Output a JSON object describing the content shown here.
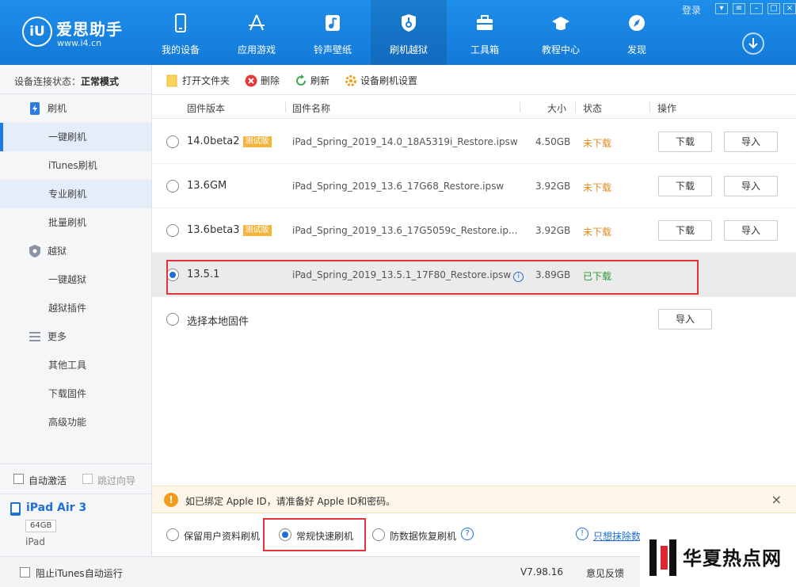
{
  "header": {
    "logo_mark": "iU",
    "logo_name": "爱思助手",
    "logo_url": "www.i4.cn",
    "login": "登录",
    "nav": [
      {
        "label": "我的设备",
        "icon": "phone-icon"
      },
      {
        "label": "应用游戏",
        "icon": "app-store-icon"
      },
      {
        "label": "铃声壁纸",
        "icon": "music-note-icon"
      },
      {
        "label": "刷机越狱",
        "icon": "shield-key-icon"
      },
      {
        "label": "工具箱",
        "icon": "toolbox-icon"
      },
      {
        "label": "教程中心",
        "icon": "graduation-cap-icon"
      },
      {
        "label": "发现",
        "icon": "compass-icon"
      }
    ],
    "active_nav": 3
  },
  "sidebar": {
    "conn_label": "设备连接状态：",
    "conn_value": "正常模式",
    "items": [
      {
        "label": "刷机",
        "type": "group",
        "icon": "phone-flash-icon"
      },
      {
        "label": "一键刷机",
        "type": "sub"
      },
      {
        "label": "iTunes刷机",
        "type": "sub"
      },
      {
        "label": "专业刷机",
        "type": "sub"
      },
      {
        "label": "批量刷机",
        "type": "sub"
      },
      {
        "label": "越狱",
        "type": "group",
        "icon": "shield-icon"
      },
      {
        "label": "一键越狱",
        "type": "sub"
      },
      {
        "label": "越狱插件",
        "type": "sub"
      },
      {
        "label": "更多",
        "type": "group",
        "icon": "menu-icon"
      },
      {
        "label": "其他工具",
        "type": "sub"
      },
      {
        "label": "下载固件",
        "type": "sub"
      },
      {
        "label": "高级功能",
        "type": "sub"
      }
    ],
    "auto_activate": "自动激活",
    "skip_guide": "跳过向导",
    "device_name": "iPad Air 3",
    "device_storage": "64GB",
    "device_type": "iPad"
  },
  "toolbar": {
    "open_folder": "打开文件夹",
    "delete": "删除",
    "refresh": "刷新",
    "settings": "设备刷机设置"
  },
  "table": {
    "headers": {
      "version": "固件版本",
      "name": "固件名称",
      "size": "大小",
      "status": "状态",
      "action": "操作"
    },
    "rows": [
      {
        "version": "14.0beta2",
        "badge": "测试版",
        "name": "iPad_Spring_2019_14.0_18A5319i_Restore.ipsw",
        "size": "4.50GB",
        "status": "未下载",
        "btn1": "下载",
        "btn2": "导入"
      },
      {
        "version": "13.6GM",
        "badge": "",
        "name": "iPad_Spring_2019_13.6_17G68_Restore.ipsw",
        "size": "3.92GB",
        "status": "未下载",
        "btn1": "下载",
        "btn2": "导入"
      },
      {
        "version": "13.6beta3",
        "badge": "测试版",
        "name": "iPad_Spring_2019_13.6_17G5059c_Restore.ip...",
        "size": "3.92GB",
        "status": "未下载",
        "btn1": "下载",
        "btn2": "导入"
      },
      {
        "version": "13.5.1",
        "badge": "",
        "name": "iPad_Spring_2019_13.5.1_17F80_Restore.ipsw",
        "size": "3.89GB",
        "status": "已下载",
        "info_mark": "i"
      }
    ],
    "local_label": "选择本地固件",
    "local_btn": "导入"
  },
  "notice": {
    "mark": "!",
    "text": "如已绑定 Apple ID，请准备好 Apple ID和密码。",
    "close": "×"
  },
  "modes": {
    "keep_data": "保留用户资料刷机",
    "quick": "常规快速刷机",
    "recovery": "防数据恢复刷机",
    "help_mark": "?",
    "erase_mark": "!",
    "erase_link": "只想抹除数"
  },
  "statusbar": {
    "block_itunes": "阻止iTunes自动运行",
    "version": "V7.98.16",
    "feedback": "意见反馈"
  },
  "watermark": {
    "text": "华夏热点网"
  }
}
